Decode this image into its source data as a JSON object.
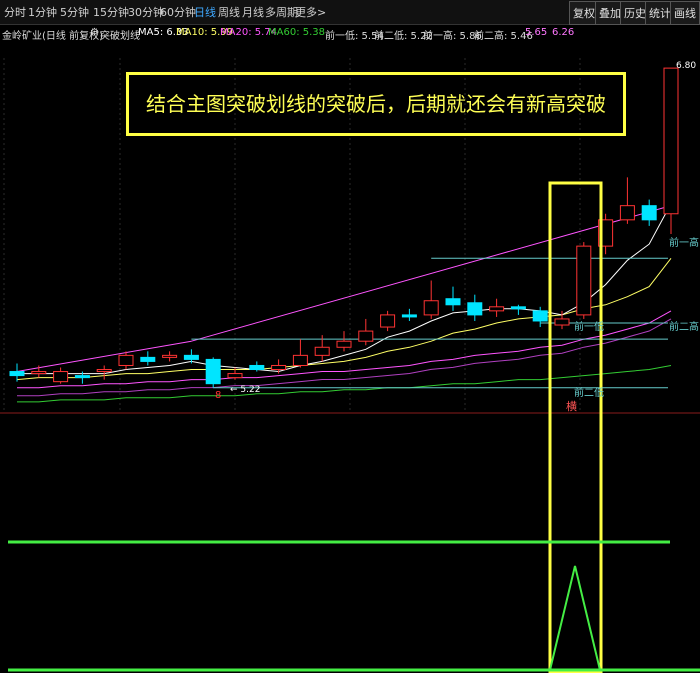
{
  "toolbar": {
    "periods": [
      "分时",
      "1分钟",
      "5分钟",
      "15分钟",
      "30分钟",
      "60分钟",
      "日线",
      "周线",
      "月线",
      "多周期",
      "更多>"
    ],
    "active_period": "日线",
    "right_buttons": [
      "复权",
      "叠加",
      "历史",
      "统计",
      "画线"
    ]
  },
  "info": {
    "stock_title": "金岭矿业(日线 前复权)",
    "indicator": "突破划线",
    "ma5": "MA5: 6.33",
    "ma10": "MA10: 5.99",
    "ma20": "MA20: 5.74",
    "ma60": "MA60: 5.38",
    "qian_yi_di": "前一低: 5.54",
    "qian_er_di": "前二低: 5.22",
    "qian_yi_gao": "前一高: 5.86",
    "qian_er_gao": "前二高: 5.46",
    "val_a": "5.65",
    "val_b": "6.26"
  },
  "annotation": "结合主图突破划线的突破后，后期就还会有新高突破",
  "chart_labels": {
    "high_price": "6.80",
    "low_price": "5.22",
    "low_marker": "8",
    "qian_yi_gao": "前一高",
    "qian_er_gao": "前二高",
    "qian_yi_di": "前一低",
    "qian_er_di": "前二低",
    "signal": "横"
  },
  "colors": {
    "up": "#ff3333",
    "down": "#00e5ff",
    "ma5": "#ffffff",
    "ma10": "#ffff66",
    "ma20": "#ff55ff",
    "ma60": "#33cc33",
    "highlight": "#ffff44",
    "indicator": "#44ee44"
  },
  "chart_data": {
    "type": "candlestick",
    "candles": [
      {
        "o": 5.3,
        "c": 5.28,
        "h": 5.34,
        "l": 5.25
      },
      {
        "o": 5.29,
        "c": 5.3,
        "h": 5.33,
        "l": 5.27
      },
      {
        "o": 5.25,
        "c": 5.3,
        "h": 5.32,
        "l": 5.24
      },
      {
        "o": 5.28,
        "c": 5.27,
        "h": 5.3,
        "l": 5.24
      },
      {
        "o": 5.3,
        "c": 5.31,
        "h": 5.33,
        "l": 5.26
      },
      {
        "o": 5.33,
        "c": 5.38,
        "h": 5.4,
        "l": 5.31
      },
      {
        "o": 5.37,
        "c": 5.35,
        "h": 5.4,
        "l": 5.33
      },
      {
        "o": 5.37,
        "c": 5.38,
        "h": 5.4,
        "l": 5.35
      },
      {
        "o": 5.38,
        "c": 5.36,
        "h": 5.41,
        "l": 5.34
      },
      {
        "o": 5.36,
        "c": 5.24,
        "h": 5.37,
        "l": 5.22
      },
      {
        "o": 5.27,
        "c": 5.29,
        "h": 5.32,
        "l": 5.26
      },
      {
        "o": 5.33,
        "c": 5.31,
        "h": 5.35,
        "l": 5.3
      },
      {
        "o": 5.31,
        "c": 5.33,
        "h": 5.36,
        "l": 5.29
      },
      {
        "o": 5.33,
        "c": 5.38,
        "h": 5.46,
        "l": 5.32
      },
      {
        "o": 5.38,
        "c": 5.42,
        "h": 5.48,
        "l": 5.35
      },
      {
        "o": 5.42,
        "c": 5.45,
        "h": 5.5,
        "l": 5.4
      },
      {
        "o": 5.45,
        "c": 5.5,
        "h": 5.56,
        "l": 5.43
      },
      {
        "o": 5.52,
        "c": 5.58,
        "h": 5.6,
        "l": 5.5
      },
      {
        "o": 5.58,
        "c": 5.57,
        "h": 5.61,
        "l": 5.55
      },
      {
        "o": 5.58,
        "c": 5.65,
        "h": 5.75,
        "l": 5.56
      },
      {
        "o": 5.66,
        "c": 5.63,
        "h": 5.72,
        "l": 5.6
      },
      {
        "o": 5.64,
        "c": 5.58,
        "h": 5.68,
        "l": 5.55
      },
      {
        "o": 5.6,
        "c": 5.62,
        "h": 5.66,
        "l": 5.57
      },
      {
        "o": 5.62,
        "c": 5.61,
        "h": 5.63,
        "l": 5.58
      },
      {
        "o": 5.6,
        "c": 5.55,
        "h": 5.62,
        "l": 5.52
      },
      {
        "o": 5.53,
        "c": 5.56,
        "h": 5.6,
        "l": 5.51
      },
      {
        "o": 5.58,
        "c": 5.92,
        "h": 5.94,
        "l": 5.56
      },
      {
        "o": 5.92,
        "c": 6.05,
        "h": 6.08,
        "l": 5.88
      },
      {
        "o": 6.05,
        "c": 6.12,
        "h": 6.26,
        "l": 6.03
      },
      {
        "o": 6.12,
        "c": 6.05,
        "h": 6.15,
        "l": 6.02
      },
      {
        "o": 6.08,
        "c": 6.8,
        "h": 6.8,
        "l": 5.98
      }
    ],
    "ylim": [
      5.1,
      6.85
    ],
    "levels": {
      "qian_yi_gao": 5.86,
      "qian_er_gao": 5.46,
      "qian_yi_di": 5.54,
      "qian_er_di": 5.22
    },
    "ma5": [
      5.29,
      5.29,
      5.29,
      5.29,
      5.29,
      5.31,
      5.32,
      5.33,
      5.35,
      5.33,
      5.32,
      5.31,
      5.3,
      5.33,
      5.35,
      5.38,
      5.41,
      5.47,
      5.5,
      5.55,
      5.59,
      5.6,
      5.61,
      5.61,
      5.6,
      5.58,
      5.64,
      5.73,
      5.85,
      5.93,
      6.13
    ],
    "ma10": [
      5.26,
      5.27,
      5.27,
      5.27,
      5.28,
      5.29,
      5.29,
      5.3,
      5.31,
      5.31,
      5.31,
      5.31,
      5.32,
      5.33,
      5.34,
      5.35,
      5.37,
      5.4,
      5.42,
      5.45,
      5.49,
      5.51,
      5.54,
      5.56,
      5.57,
      5.58,
      5.61,
      5.63,
      5.67,
      5.72,
      5.86
    ],
    "ma20": [
      5.22,
      5.22,
      5.23,
      5.23,
      5.24,
      5.24,
      5.25,
      5.25,
      5.26,
      5.26,
      5.27,
      5.27,
      5.28,
      5.29,
      5.3,
      5.3,
      5.31,
      5.32,
      5.33,
      5.35,
      5.36,
      5.38,
      5.39,
      5.4,
      5.42,
      5.43,
      5.46,
      5.48,
      5.51,
      5.54,
      5.6
    ],
    "ma60": [
      5.15,
      5.15,
      5.16,
      5.16,
      5.16,
      5.17,
      5.17,
      5.17,
      5.18,
      5.18,
      5.18,
      5.19,
      5.19,
      5.2,
      5.2,
      5.21,
      5.21,
      5.22,
      5.22,
      5.23,
      5.24,
      5.24,
      5.25,
      5.26,
      5.26,
      5.27,
      5.28,
      5.29,
      5.3,
      5.31,
      5.33
    ]
  }
}
